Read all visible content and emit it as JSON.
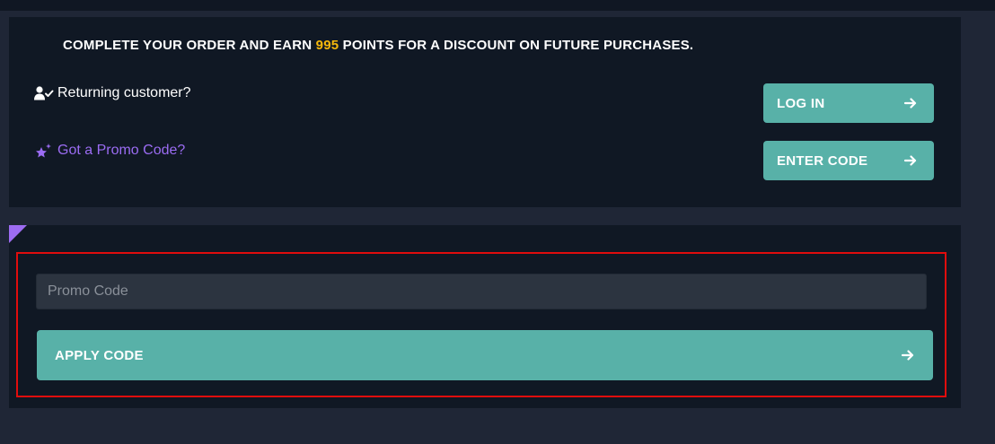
{
  "banner": {
    "headline_before": "COMPLETE YOUR ORDER AND EARN ",
    "points": "995",
    "headline_after": " POINTS FOR A DISCOUNT ON FUTURE PURCHASES."
  },
  "returning_customer": {
    "label": "Returning customer?",
    "icon": "user-check-icon",
    "button_label": "LOG IN"
  },
  "promo": {
    "label": "Got a Promo Code?",
    "icon": "sparkle-star-icon",
    "button_label": "ENTER CODE"
  },
  "promo_form": {
    "placeholder": "Promo Code",
    "value": "",
    "apply_label": "APPLY CODE"
  },
  "colors": {
    "page_background": "#1f2636",
    "panel_background": "#101824",
    "accent_teal": "#58b1a8",
    "points_yellow": "#f5b80c",
    "promo_purple": "#9b6cf3",
    "highlight_red": "#e00d0d"
  }
}
